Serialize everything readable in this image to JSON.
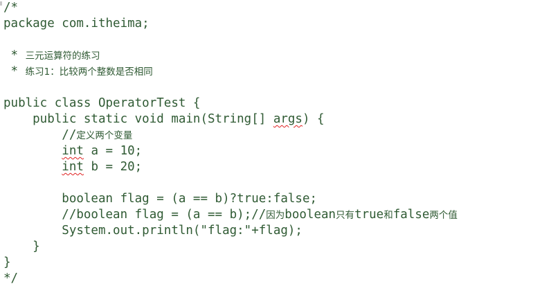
{
  "code": {
    "comment_open": "/*",
    "package_line": "package com.itheima;",
    "comment_star_1": " * ",
    "comment_text_1": "三元运算符的练习",
    "comment_star_2": " * ",
    "comment_text_2": "练习1：比较两个整数是否相同",
    "class_decl": "public class OperatorTest {",
    "main_prefix": "    public static void main(String[] ",
    "main_args": "args",
    "main_suffix": ") {",
    "indent_comment": "        //",
    "var_comment": "定义两个变量",
    "indent_int": "        ",
    "int_kw_1": "int",
    "int_a_rest": " a = 10;",
    "int_kw_2": "int",
    "int_b_rest": " b = 20;",
    "ternary_line": "        boolean flag = (a == b)?true:false;",
    "commented_line_code": "        //boolean flag = (a == b);//",
    "commented_cjk_1": "因为",
    "commented_boolean": "boolean",
    "commented_cjk_2": "只有",
    "commented_true": "true",
    "commented_cjk_3": "和",
    "commented_false": "false",
    "commented_cjk_4": "两个值",
    "println_line": "        System.out.println(\"flag:\"+flag);",
    "close_method": "    }",
    "close_class": "}",
    "comment_close": "*/"
  },
  "colors": {
    "code_text": "#2f5a33",
    "squiggle": "#e02020",
    "background": "#ffffff"
  }
}
